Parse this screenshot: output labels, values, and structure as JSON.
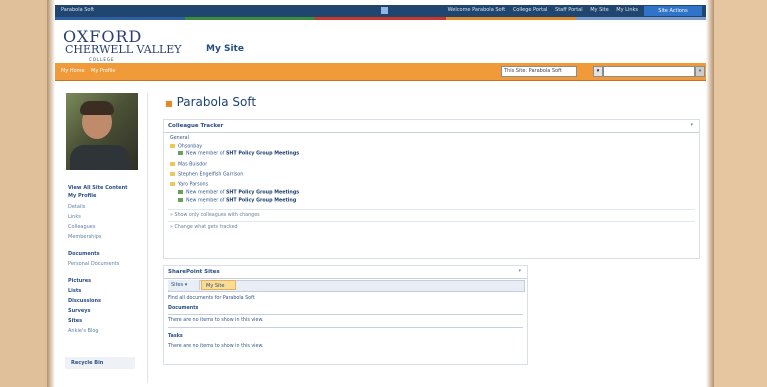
{
  "topbar": {
    "site_name": "Parabola Soft",
    "links": [
      "Welcome Parabola Soft",
      "College Portal",
      "Staff Portal",
      "My Site",
      "My Links"
    ],
    "action_button": "Site Actions"
  },
  "header": {
    "logo_line1": "OXFORD",
    "logo_line2": "CHERWELL VALLEY",
    "logo_line3": "COLLEGE",
    "title": "My Site"
  },
  "nav": {
    "tabs": [
      "My Home",
      "My Profile"
    ],
    "search_scope": "This Site: Parabola Soft",
    "search_scope_arrow": "▾",
    "search_go": "»"
  },
  "left": {
    "view_all": "View All Site Content",
    "my_profile": "My Profile",
    "profile_items": [
      "Details",
      "Links",
      "Colleagues",
      "Memberships"
    ],
    "documents": "Documents",
    "document_items": [
      "Personal Documents"
    ],
    "pictures": "Pictures",
    "lists": "Lists",
    "discussions": "Discussions",
    "surveys": "Surveys",
    "sites": "Sites",
    "site_items": [
      "Ankie's Blog"
    ],
    "recycle": "Recycle Bin"
  },
  "main": {
    "title": "Parabola Soft",
    "colleagues": {
      "title": "Colleague Tracker",
      "menu": "▾",
      "group_general": "General",
      "entries": [
        {
          "name": "Ohsonbay",
          "activity": "New member of ",
          "group": "SHT Policy Group Meetings"
        },
        {
          "name": "Mas Buisdor",
          "activity": "",
          "group": ""
        },
        {
          "name": "Stephen Engelfish Garrison",
          "activity": "",
          "group": ""
        },
        {
          "name": "Yaro Parsons",
          "activity": "New member of ",
          "group": "SHT Policy Group Meetings"
        },
        {
          "name": "",
          "activity": "New member of ",
          "group": "SHT Policy Group Meeting"
        }
      ],
      "show_only": "Show only colleagues with changes",
      "change_tracked": "Change what gets tracked"
    },
    "sharepoint": {
      "title": "SharePoint Sites",
      "menu": "▾",
      "tab_sites": "Sites ▾",
      "tab_mysite": "My Site",
      "intro": "Find all documents for Parabola Soft",
      "documents_heading": "Documents",
      "documents_empty": "There are no items to show in this view.",
      "tasks_heading": "Tasks",
      "tasks_empty": "There are no items to show in this view."
    }
  },
  "colors": {
    "topbar": "#20466f",
    "nav_orange": "#f09a3a",
    "link_blue": "#264c80",
    "stripe": [
      "#2f5fa0",
      "#3c8c3c",
      "#c8372c",
      "#e08a2a",
      "#7a9cc7"
    ]
  }
}
